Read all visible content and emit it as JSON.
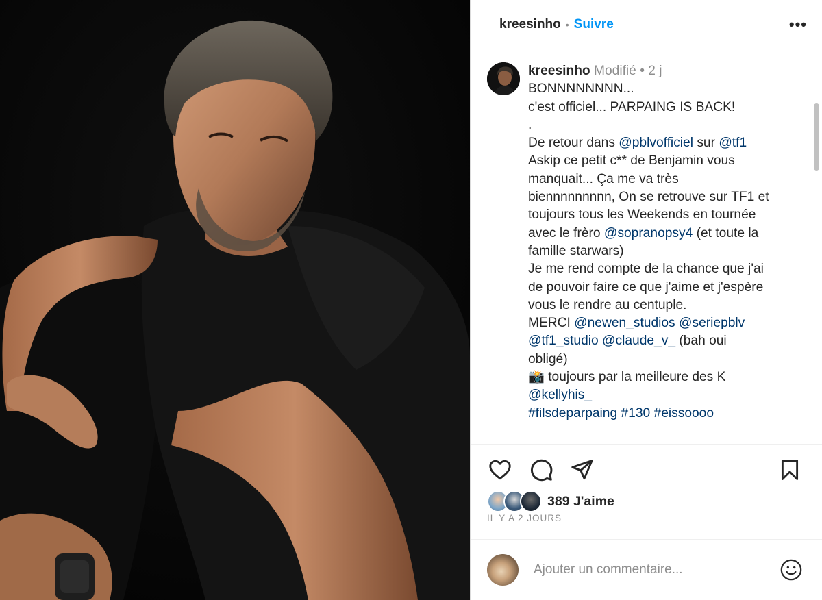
{
  "header": {
    "username": "kreesinho",
    "separator": "•",
    "follow_label": "Suivre",
    "more_label": "•••"
  },
  "caption": {
    "username": "kreesinho",
    "edited_label": "Modifié",
    "separator": "•",
    "time": "2 j",
    "lines": [
      [
        {
          "t": "BONNNNNNNN...",
          "m": false
        }
      ],
      [
        {
          "t": "c'est officiel... PARPAING IS BACK!",
          "m": false
        }
      ],
      [
        {
          "t": ".",
          "m": false
        }
      ],
      [
        {
          "t": "De retour dans ",
          "m": false
        },
        {
          "t": "@pblvofficiel",
          "m": true
        },
        {
          "t": " sur ",
          "m": false
        },
        {
          "t": "@tf1",
          "m": true
        }
      ],
      [
        {
          "t": "Askip ce petit c** de Benjamin vous",
          "m": false
        }
      ],
      [
        {
          "t": "manquait... Ça me va très",
          "m": false
        }
      ],
      [
        {
          "t": "biennnnnnnnn, On se retrouve sur TF1 et",
          "m": false
        }
      ],
      [
        {
          "t": "toujours tous les Weekends en tournée",
          "m": false
        }
      ],
      [
        {
          "t": "avec le frèro ",
          "m": false
        },
        {
          "t": "@sopranopsy4",
          "m": true
        },
        {
          "t": " (et toute la",
          "m": false
        }
      ],
      [
        {
          "t": "famille starwars)",
          "m": false
        }
      ],
      [
        {
          "t": "Je me rend compte de la chance que j'ai",
          "m": false
        }
      ],
      [
        {
          "t": "de pouvoir faire ce que j'aime et j'espère",
          "m": false
        }
      ],
      [
        {
          "t": "vous le rendre au centuple.",
          "m": false
        }
      ],
      [
        {
          "t": "MERCI ",
          "m": false
        },
        {
          "t": "@newen_studios",
          "m": true
        },
        {
          "t": " ",
          "m": false
        },
        {
          "t": "@seriepblv",
          "m": true
        }
      ],
      [
        {
          "t": "@tf1_studio",
          "m": true
        },
        {
          "t": " ",
          "m": false
        },
        {
          "t": "@claude_v_",
          "m": true
        },
        {
          "t": " (bah oui",
          "m": false
        }
      ],
      [
        {
          "t": "obligé)",
          "m": false
        }
      ],
      [
        {
          "t": "📸 toujours par la meilleure des K",
          "m": false
        }
      ],
      [
        {
          "t": "@kellyhis_",
          "m": true
        }
      ],
      [
        {
          "t": "#filsdeparpaing",
          "m": true
        },
        {
          "t": " ",
          "m": false
        },
        {
          "t": "#130",
          "m": true
        },
        {
          "t": " ",
          "m": false
        },
        {
          "t": "#eissoooo",
          "m": true
        }
      ]
    ]
  },
  "actions": {
    "like_icon": "heart-outline",
    "comment_icon": "speech-bubble",
    "share_icon": "paper-plane",
    "save_icon": "bookmark-outline"
  },
  "likes": {
    "count_label": "389 J'aime",
    "face_colors": [
      "#7fa7c9",
      "#3b5a7a",
      "#1f2a38"
    ]
  },
  "time_ago": "IL Y A 2 JOURS",
  "comment": {
    "placeholder": "Ajouter un commentaire...",
    "emoji_icon": "smiley-face"
  },
  "colors": {
    "accent": "#0095f6",
    "mention": "#00376b",
    "muted": "#8e8e8e",
    "text": "#262626"
  }
}
